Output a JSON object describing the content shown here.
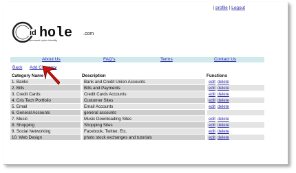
{
  "header": {
    "sep1": "|",
    "profile_link": "profile",
    "sep2": "|",
    "logout_link": "Logout",
    "logo_text": "hole",
    "logo_suffix": ".com",
    "tagline": "personal cyber identity"
  },
  "nav": [
    "About Us",
    "FAQ's",
    "Terms",
    "Contact Us"
  ],
  "sublinks": {
    "back": "Back",
    "add_category": "Add Category"
  },
  "table": {
    "headers": [
      "Category Name",
      "Description",
      "Functions"
    ],
    "edit_label": "edit",
    "delete_label": "delete",
    "rows": [
      {
        "name": "1. Banks",
        "description": "Bank and Credit Union Accounts",
        "edit": "edit",
        "delete": "delete"
      },
      {
        "name": "2. Bills",
        "description": "Bills and Payments",
        "edit": "edit",
        "delete": "delete"
      },
      {
        "name": "3. Credit Cards",
        "description": "Credit Cards Accounts",
        "edit": "edit",
        "delete": "delete"
      },
      {
        "name": "4. Cris Tech Portfolio",
        "description": "Customer Sites",
        "edit": "edit",
        "delete": "delete"
      },
      {
        "name": "5. Email",
        "description": "Email Accounts",
        "edit": "edit",
        "delete": "delete"
      },
      {
        "name": "6. General Accounts",
        "description": "general accounts",
        "edit": "",
        "delete": ""
      },
      {
        "name": "7. Music",
        "description": "Music Downloading Sites",
        "edit": "edit",
        "delete": "delete"
      },
      {
        "name": "8. Shopping",
        "description": "Shopping Sites",
        "edit": "edit",
        "delete": "delete"
      },
      {
        "name": "9. Social Networking",
        "description": "Facebook, Twitter, Etc.",
        "edit": "edit",
        "delete": "delete"
      },
      {
        "name": "10. Web Design",
        "description": "photo stock exchanges and tutorials",
        "edit": "edit",
        "delete": "delete"
      }
    ]
  },
  "colors": {
    "link": "#2b2ba8",
    "nav_bg": "#cfe9ec",
    "row_light": "#e4e4e4",
    "row_dark": "#cdcdcd",
    "cursor": "#cc1111"
  },
  "icons": {
    "cursor": "red-arrow-cursor-icon"
  }
}
